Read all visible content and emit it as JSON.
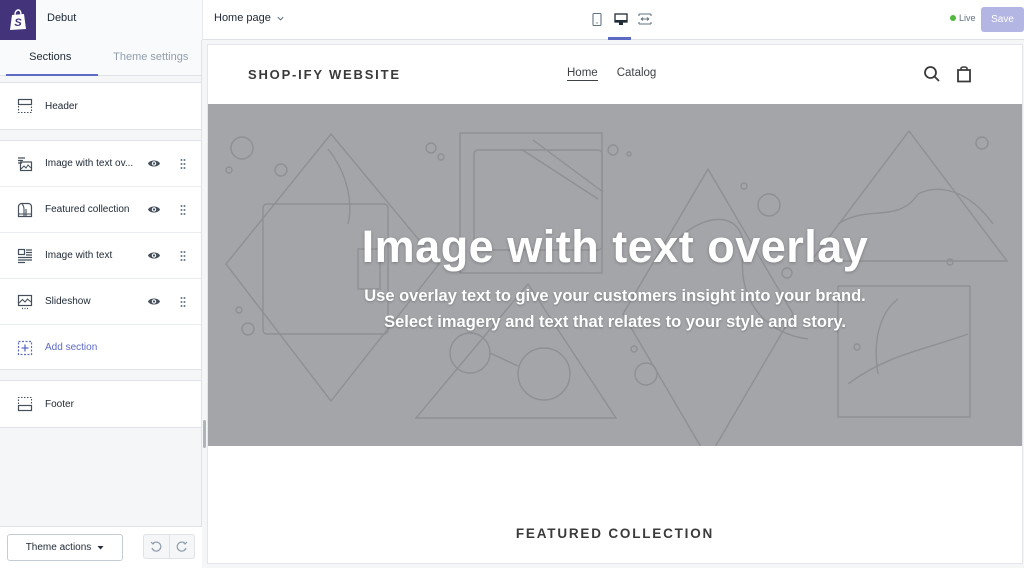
{
  "topbar": {
    "theme_name": "Debut",
    "page_selector": "Home page",
    "live_label": "Live",
    "save_label": "Save",
    "devices": [
      "mobile-icon",
      "desktop-icon",
      "fullscreen-icon"
    ],
    "active_device": "desktop"
  },
  "sidebar": {
    "tabs": [
      {
        "label": "Sections",
        "active": true
      },
      {
        "label": "Theme settings",
        "active": false
      }
    ],
    "header_item": {
      "label": "Header",
      "icon": "header-icon"
    },
    "sections": [
      {
        "label": "Image with text ov...",
        "icon": "image-overlay-icon"
      },
      {
        "label": "Featured collection",
        "icon": "collection-icon"
      },
      {
        "label": "Image with text",
        "icon": "image-text-icon"
      },
      {
        "label": "Slideshow",
        "icon": "slideshow-icon"
      }
    ],
    "add_section_label": "Add section",
    "footer_item": {
      "label": "Footer",
      "icon": "footer-icon"
    },
    "theme_actions_label": "Theme actions"
  },
  "preview": {
    "site_logo": "SHOP-IFY WEBSITE",
    "nav": [
      {
        "label": "Home",
        "active": true
      },
      {
        "label": "Catalog",
        "active": false
      }
    ],
    "hero": {
      "title": "Image with text overlay",
      "subtitle_line1": "Use overlay text to give your customers insight into your brand.",
      "subtitle_line2": "Select imagery and text that relates to your style and story."
    },
    "featured_heading": "FEATURED COLLECTION"
  },
  "colors": {
    "brand_purple": "#43337a",
    "accent": "#5c6ac4",
    "live_green": "#50b83c",
    "hero_bg": "#a3a5a9"
  }
}
